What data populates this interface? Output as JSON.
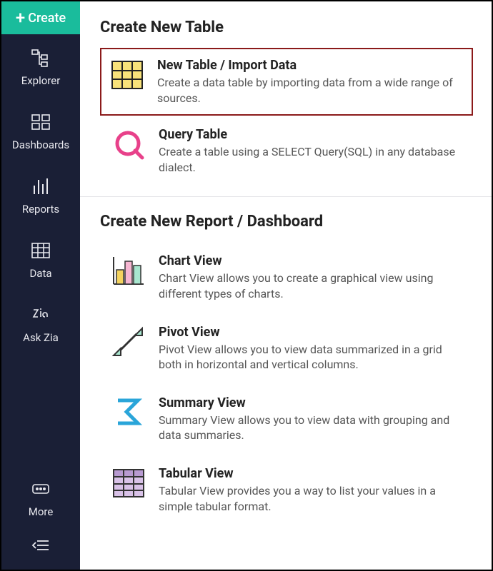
{
  "sidebar": {
    "create_label": "Create",
    "items": [
      {
        "label": "Explorer"
      },
      {
        "label": "Dashboards"
      },
      {
        "label": "Reports"
      },
      {
        "label": "Data"
      },
      {
        "label": "Ask Zia"
      }
    ],
    "more_label": "More"
  },
  "sections": {
    "table": {
      "title": "Create New Table",
      "options": [
        {
          "title": "New Table / Import Data",
          "desc": "Create a data table by importing data from a wide range of sources."
        },
        {
          "title": "Query Table",
          "desc": "Create a table using a SELECT Query(SQL) in any database dialect."
        }
      ]
    },
    "report": {
      "title": "Create New Report / Dashboard",
      "options": [
        {
          "title": "Chart View",
          "desc": "Chart View allows you to create a graphical view using different types of charts."
        },
        {
          "title": "Pivot View",
          "desc": "Pivot View allows you to view data summarized in a grid both in horizontal and vertical columns."
        },
        {
          "title": "Summary View",
          "desc": "Summary View allows you to view data with grouping and data summaries."
        },
        {
          "title": "Tabular View",
          "desc": "Tabular View provides you a way to list your values in a simple tabular format."
        }
      ]
    }
  }
}
